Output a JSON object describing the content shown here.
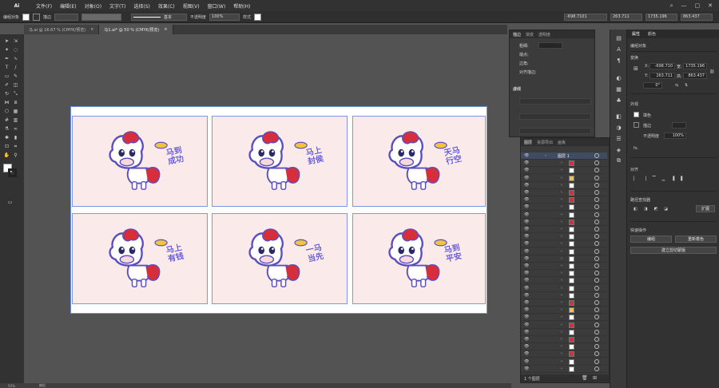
{
  "app": {
    "logo": "Ai"
  },
  "menu": [
    "文件(F)",
    "编辑(E)",
    "对象(O)",
    "文字(T)",
    "选择(S)",
    "效果(C)",
    "视图(V)",
    "窗口(W)",
    "帮助(H)"
  ],
  "control_bar": {
    "selection": "编组对象",
    "stroke_label": "描边",
    "stroke_style": "基本",
    "opacity_label": "不透明度",
    "opacity_value": "100%",
    "style_label": "样式",
    "x": "-698.7101",
    "y": "263.711",
    "w": "1735.196",
    "h": "863.437"
  },
  "tabs": [
    {
      "label": "马.ai @ 16.67 % (CMYK/预览)",
      "close": "×"
    },
    {
      "label": "马1.ai* @ 50 % (CMYK/预览)",
      "close": "×"
    }
  ],
  "layers_panel": {
    "tabs": [
      "图层",
      "资源导出",
      "画板"
    ],
    "top_layer": "图层 1",
    "footer": "1 个图层"
  },
  "top_panel": {
    "tabs": [
      "描边",
      "渐变",
      "透明度"
    ],
    "rows": [
      "粗细:",
      "端点:",
      "边角:",
      "对齐描边:"
    ],
    "section": "虚线"
  },
  "properties": {
    "tabs": [
      "属性",
      "颜色"
    ],
    "object_type": "编组对象",
    "transform_title": "变换",
    "x_label": "X:",
    "x": "-698.710",
    "y_label": "Y:",
    "y": "263.711",
    "w_label": "宽:",
    "w": "1735.196",
    "h_label": "高:",
    "h": "863.437",
    "angle": "0°",
    "appearance_title": "外观",
    "fill_label": "填色",
    "stroke_label": "描边",
    "opacity_label": "不透明度",
    "opacity": "100%",
    "fx": "fx.",
    "align_title": "对齐",
    "pathfinder_title": "路径查找器",
    "expand": "扩展",
    "quick_actions_title": "快速操作",
    "btn_edit": "编组",
    "btn_recolor": "重新着色",
    "btn_clip": "建立剪切蒙版"
  },
  "illustrations": [
    {
      "caption": "马到成功"
    },
    {
      "caption": "马上封侯"
    },
    {
      "caption": "天马行空"
    },
    {
      "caption": "马上有钱"
    },
    {
      "caption": "一马当先"
    },
    {
      "caption": "马到平安"
    }
  ],
  "status": {
    "zoom": "50%",
    "info": "编组"
  }
}
